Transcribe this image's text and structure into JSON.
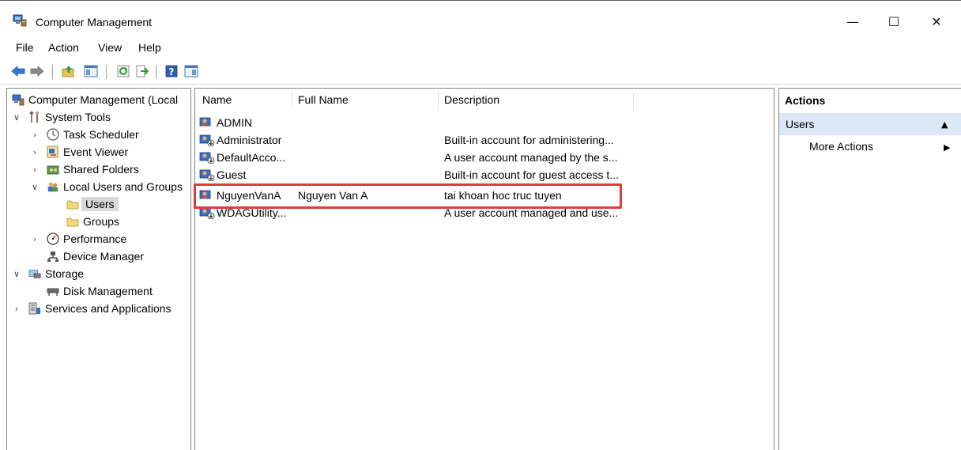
{
  "window": {
    "title": "Computer Management",
    "minimize_glyph": "—",
    "maximize_glyph": "☐",
    "close_glyph": "✕"
  },
  "menu": {
    "items": [
      "File",
      "Action",
      "View",
      "Help"
    ]
  },
  "toolbar": {
    "icons": [
      "back-arrow-icon",
      "forward-arrow-icon",
      "up-folder-icon",
      "show-hide-tree-icon",
      "refresh-icon",
      "export-list-icon",
      "help-icon",
      "show-hide-action-pane-icon"
    ]
  },
  "tree": {
    "root": "Computer Management (Local",
    "system_tools": "System Tools",
    "task_scheduler": "Task Scheduler",
    "event_viewer": "Event Viewer",
    "shared_folders": "Shared Folders",
    "local_users_groups": "Local Users and Groups",
    "users": "Users",
    "groups": "Groups",
    "performance": "Performance",
    "device_manager": "Device Manager",
    "storage": "Storage",
    "disk_management": "Disk Management",
    "services_apps": "Services and Applications"
  },
  "list": {
    "columns": [
      "Name",
      "Full Name",
      "Description"
    ],
    "rows": [
      {
        "name": "ADMIN",
        "full_name": "",
        "description": ""
      },
      {
        "name": "Administrator",
        "full_name": "",
        "description": "Built-in account for administering..."
      },
      {
        "name": "DefaultAcco...",
        "full_name": "",
        "description": "A user account managed by the s..."
      },
      {
        "name": "Guest",
        "full_name": "",
        "description": "Built-in account for guest access t..."
      },
      {
        "name": "NguyenVanA",
        "full_name": "Nguyen Van A",
        "description": "tai khoan hoc truc tuyen"
      },
      {
        "name": "WDAGUtility...",
        "full_name": "",
        "description": "A user account managed and use..."
      }
    ]
  },
  "actions": {
    "header": "Actions",
    "section": "Users",
    "more_actions": "More Actions",
    "section_collapse_glyph": "▲",
    "more_actions_glyph": "▶"
  },
  "colors": {
    "highlight": "#e03a3a",
    "selection_bg": "#d9d9d9",
    "actions_section_bg": "#dce8f5"
  }
}
